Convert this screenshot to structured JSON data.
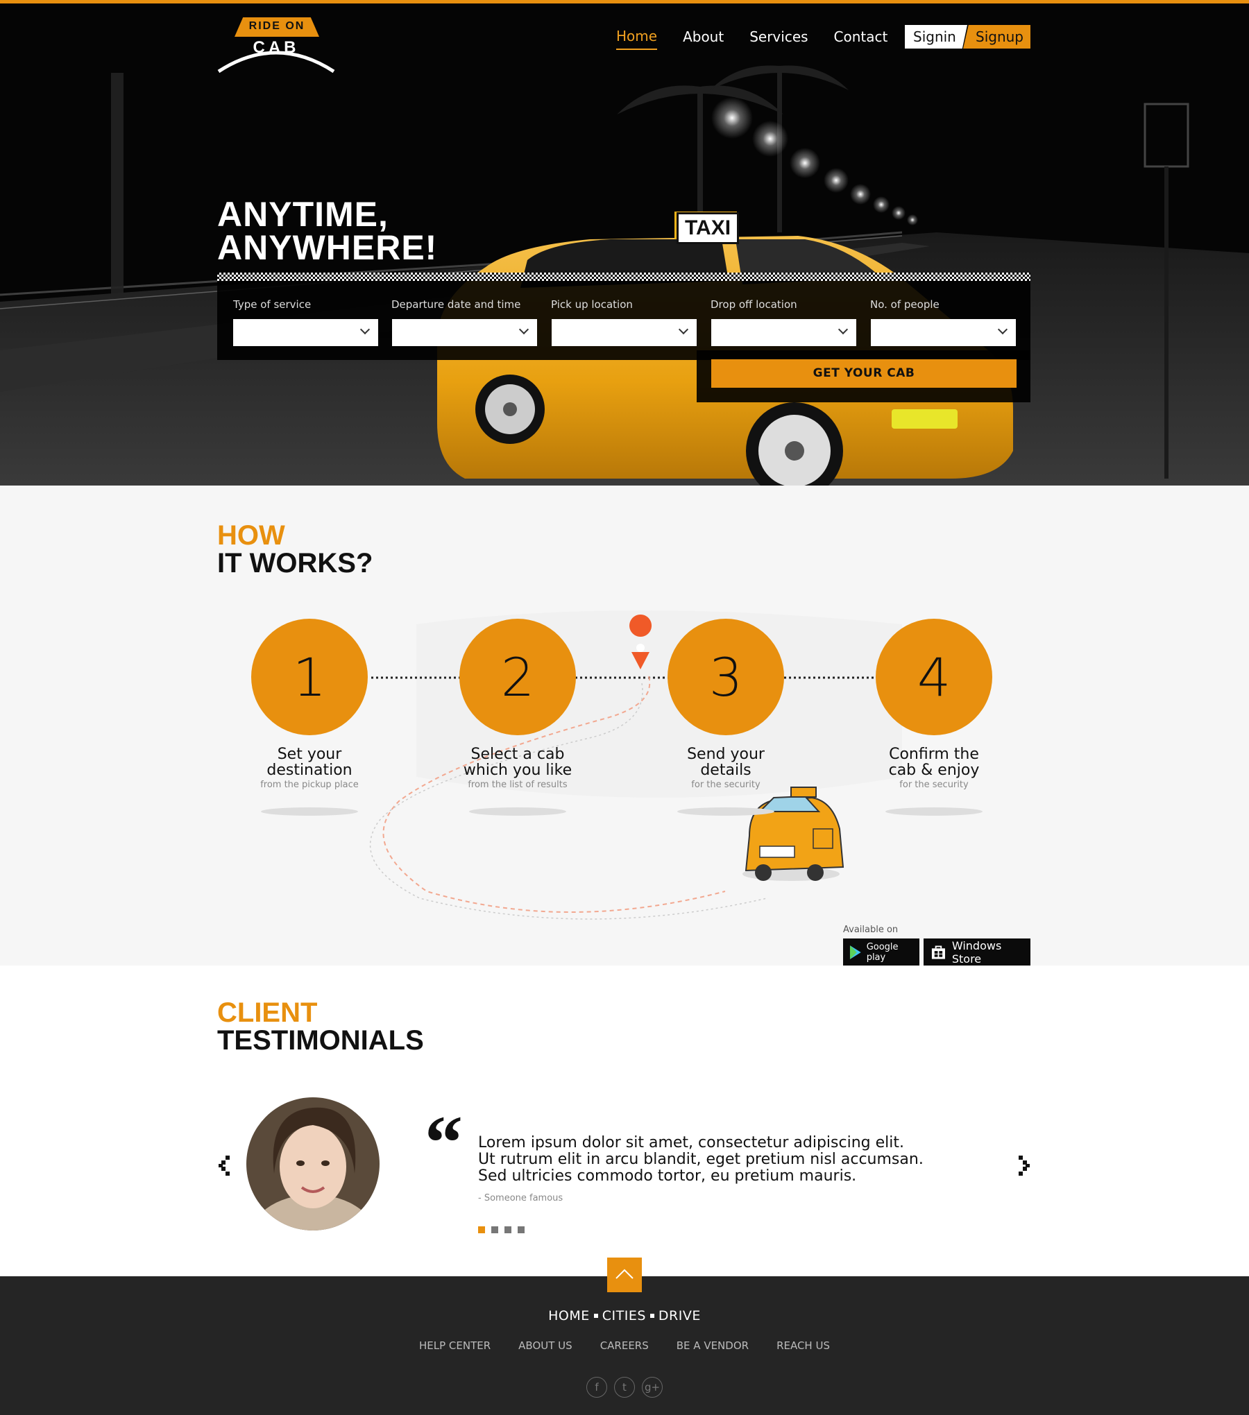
{
  "brand": {
    "logo_top": "RIDE ON",
    "logo_bottom": "CAB",
    "accent": "#e8900f"
  },
  "nav": {
    "items": [
      "Home",
      "About",
      "Services",
      "Contact"
    ],
    "active": "Home",
    "signin": "Signin",
    "signup": "Signup"
  },
  "hero": {
    "headline_line1": "ANYTIME,",
    "headline_line2": "ANYWHERE!",
    "taxi_sign": "TAXI",
    "fields": [
      {
        "label": "Type of service",
        "value": ""
      },
      {
        "label": "Departure date and time",
        "value": ""
      },
      {
        "label": "Pick up location",
        "value": ""
      },
      {
        "label": "Drop off location",
        "value": ""
      },
      {
        "label": "No. of people",
        "value": ""
      }
    ],
    "cta": "GET YOUR CAB"
  },
  "how": {
    "title_line1": "HOW",
    "title_line2": "IT WORKS?",
    "steps": [
      {
        "num": "1",
        "title1": "Set your",
        "title2": "destination",
        "sub": "from the pickup place"
      },
      {
        "num": "2",
        "title1": "Select a cab",
        "title2": "which you like",
        "sub": "from the list of results"
      },
      {
        "num": "3",
        "title1": "Send your",
        "title2": "details",
        "sub": "for the security"
      },
      {
        "num": "4",
        "title1": "Confirm the",
        "title2": "cab & enjoy",
        "sub": "for the security"
      }
    ],
    "available_on": "Available on",
    "google_play": "Google play",
    "windows_store": "Windows Store"
  },
  "testimonials": {
    "title_line1": "CLIENT",
    "title_line2": "TESTIMONIALS",
    "quote_line1": "Lorem ipsum dolor sit amet, consectetur adipiscing elit.",
    "quote_line2": "Ut rutrum elit in arcu blandit, eget pretium nisl accumsan.",
    "quote_line3": "Sed ultricies commodo tortor, eu pretium mauris.",
    "author": "- Someone famous",
    "active_slide": 1,
    "slide_count": 4
  },
  "footer": {
    "main_links": [
      "HOME",
      "CITIES",
      "DRIVE"
    ],
    "links": [
      "HELP CENTER",
      "ABOUT US",
      "CAREERS",
      "BE A VENDOR",
      "REACH US"
    ],
    "social_icons": [
      "facebook-icon",
      "twitter-icon",
      "google-plus-icon"
    ]
  }
}
